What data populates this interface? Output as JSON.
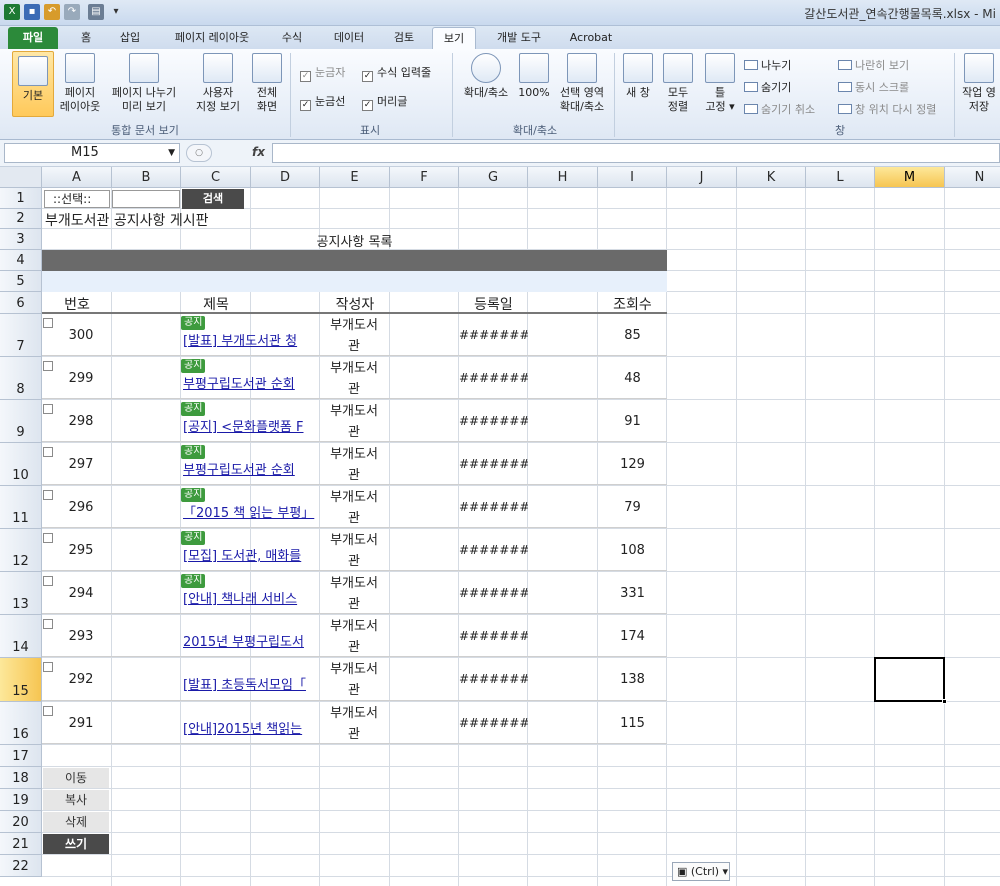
{
  "window": {
    "title": "갈산도서관_연속간행물목록.xlsx - Mi"
  },
  "ribbon_tabs": [
    {
      "label": "파일"
    },
    {
      "label": "홈"
    },
    {
      "label": "삽입"
    },
    {
      "label": "페이지 레이아웃"
    },
    {
      "label": "수식"
    },
    {
      "label": "데이터"
    },
    {
      "label": "검토"
    },
    {
      "label": "보기"
    },
    {
      "label": "개발 도구"
    },
    {
      "label": "Acrobat"
    }
  ],
  "ribbon": {
    "basic": "기본",
    "page_layout_1": "페이지",
    "page_layout_2": "레이아웃",
    "page_break_1": "페이지 나누기",
    "page_break_2": "미리 보기",
    "custom_view_1": "사용자",
    "custom_view_2": "지정 보기",
    "full_screen_1": "전체",
    "full_screen_2": "화면",
    "group_workbook_views": "통합 문서 보기",
    "ruler": "눈금자",
    "formula_bar": "수식 입력줄",
    "gridlines": "눈금선",
    "headings": "머리글",
    "group_show": "표시",
    "zoom": "확대/축소",
    "zoom100": "100%",
    "zoom_sel_1": "선택 영역",
    "zoom_sel_2": "확대/축소",
    "group_zoom": "확대/축소",
    "new_window": "새 창",
    "arrange_1": "모두",
    "arrange_2": "정렬",
    "freeze_1": "틀",
    "freeze_2": "고정 ▾",
    "split": "나누기",
    "hide": "숨기기",
    "unhide": "숨기기 취소",
    "side_by_side": "나란히 보기",
    "sync_scroll": "동시 스크롤",
    "reset_pos": "창 위치 다시 정렬",
    "group_window": "창",
    "save_ws_1": "작업 영",
    "save_ws_2": "저장"
  },
  "formula_bar": {
    "name_box": "M15",
    "fx": "fx",
    "value": ""
  },
  "columns": [
    "A",
    "B",
    "C",
    "D",
    "E",
    "F",
    "G",
    "H",
    "I",
    "J",
    "K",
    "L",
    "M",
    "N"
  ],
  "rows": [
    "1",
    "2",
    "3",
    "4",
    "5",
    "6",
    "7",
    "8",
    "9",
    "10",
    "11",
    "12",
    "13",
    "14",
    "15",
    "16",
    "17",
    "18",
    "19",
    "20",
    "21",
    "22"
  ],
  "sheet": {
    "select_label": "::선택::",
    "search_button": "검색",
    "board_title": "부개도서관 공지사항 게시판",
    "list_title": "공지사항 목록",
    "headers": {
      "no": "번호",
      "title": "제목",
      "author": "작성자",
      "date": "등록일",
      "views": "조회수"
    },
    "notice_badge": "공지",
    "author_1": "부개도서",
    "author_2": "관",
    "posts": [
      {
        "no": "300",
        "title": "[발표] 부개도서관 청",
        "date": "#######",
        "views": "85",
        "badge": true
      },
      {
        "no": "299",
        "title": "부평구립도서관 순회",
        "date": "#######",
        "views": "48",
        "badge": true
      },
      {
        "no": "298",
        "title": "[공지] <문화플랫폼 F",
        "date": "#######",
        "views": "91",
        "badge": true
      },
      {
        "no": "297",
        "title": "부평구립도서관 순회",
        "date": "#######",
        "views": "129",
        "badge": true
      },
      {
        "no": "296",
        "title": "「2015 책 읽는 부평」",
        "date": "#######",
        "views": "79",
        "badge": true
      },
      {
        "no": "295",
        "title": "[모집] 도서관, 매화를",
        "date": "#######",
        "views": "108",
        "badge": true
      },
      {
        "no": "294",
        "title": "[안내] 책나래 서비스",
        "date": "#######",
        "views": "331",
        "badge": true
      },
      {
        "no": "293",
        "title": "2015년 부평구립도서",
        "date": "#######",
        "views": "174",
        "badge": false
      },
      {
        "no": "292",
        "title": "[발표] 초등독서모임「",
        "date": "#######",
        "views": "138",
        "badge": false
      },
      {
        "no": "291",
        "title": "[안내]2015년 책읽는",
        "date": "#######",
        "views": "115",
        "badge": false
      }
    ],
    "actions": {
      "move": "이동",
      "copy": "복사",
      "delete": "삭제",
      "write": "쓰기"
    },
    "paste_options": "(Ctrl) ▾"
  }
}
